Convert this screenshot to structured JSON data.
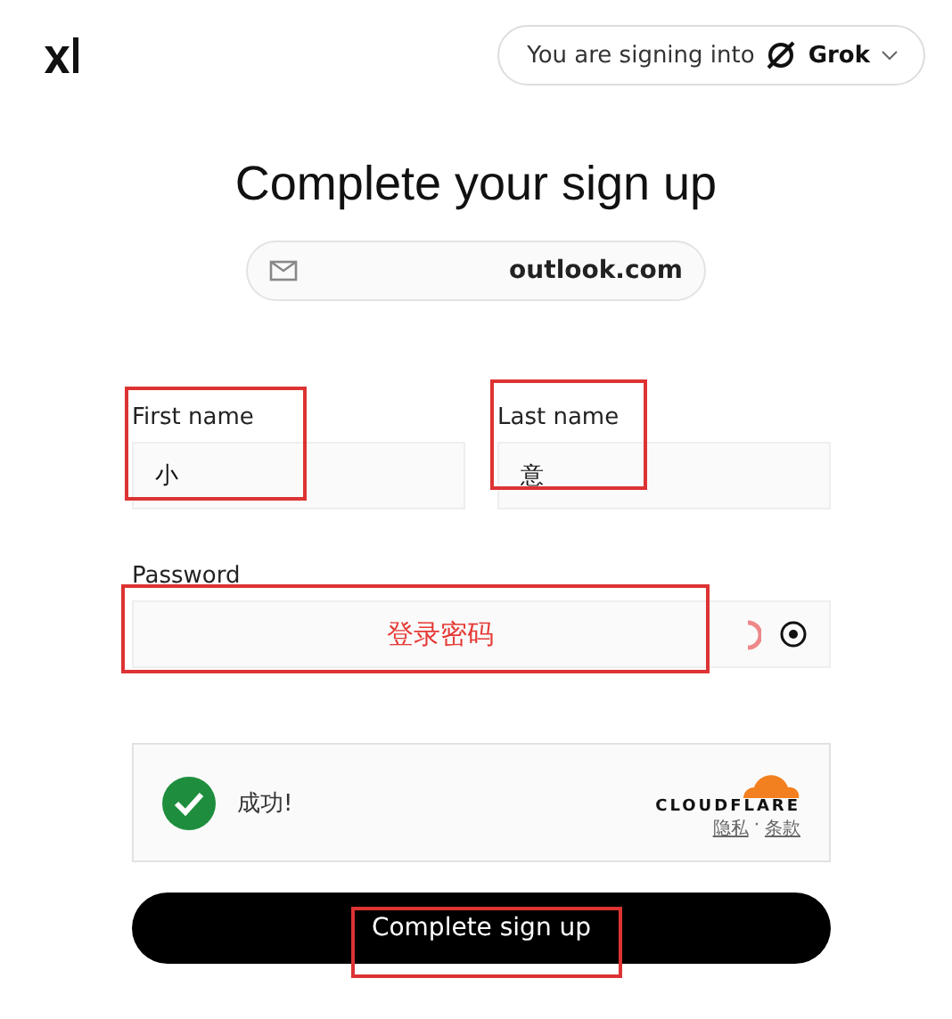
{
  "header": {
    "signing_into": "You are signing into",
    "app": "Grok"
  },
  "title": "Complete your sign up",
  "email": {
    "value": "outlook.com"
  },
  "names": [
    {
      "label": "First name",
      "value": "小",
      "highlighted": true
    },
    {
      "label": "Last name",
      "value": "意",
      "highlighted": true
    }
  ],
  "password": {
    "label": "Password",
    "annotation": "登录密码",
    "highlighted": true
  },
  "captcha": {
    "status": "成功!",
    "verified": true,
    "brand": "CLOUDFLARE",
    "links": [
      "隐私",
      "条款"
    ],
    "separator": "·"
  },
  "submit": {
    "label": "Complete sign up",
    "highlighted": true
  }
}
